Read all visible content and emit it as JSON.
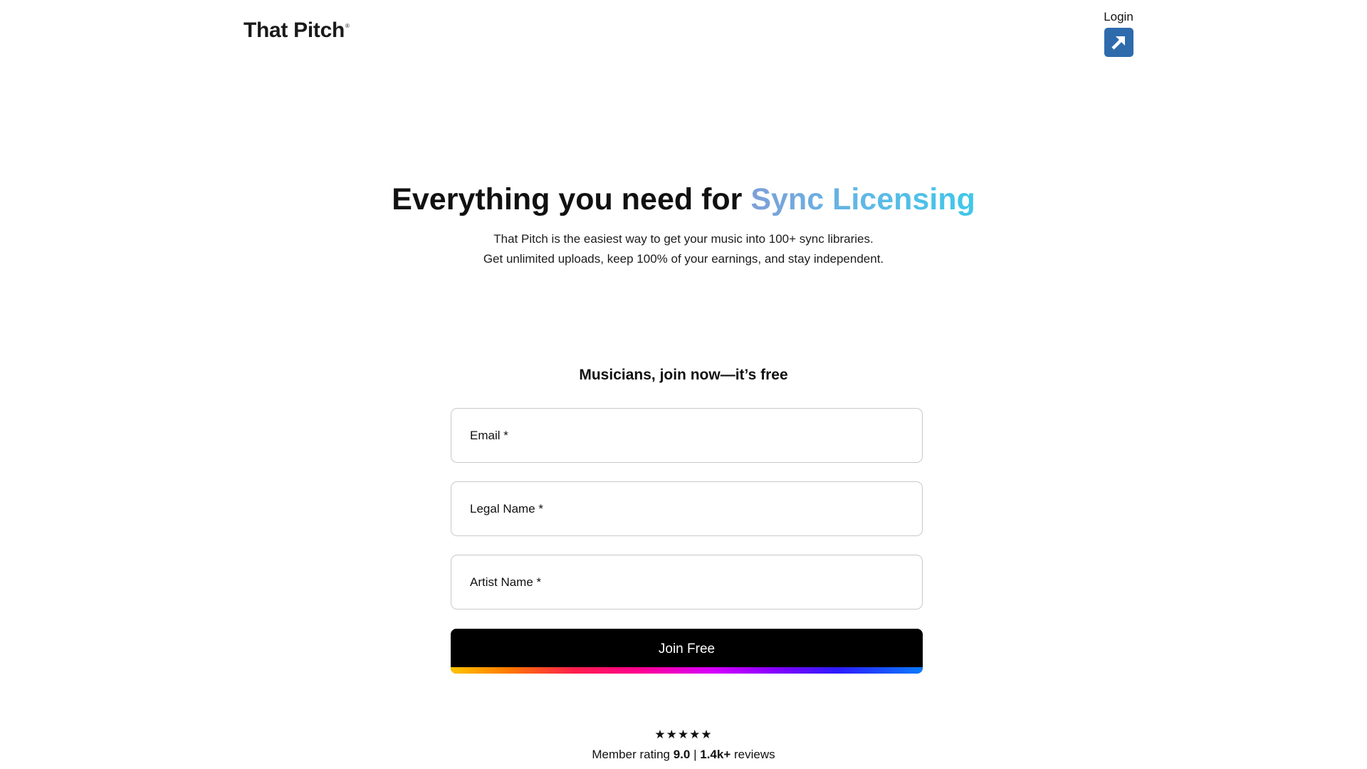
{
  "header": {
    "logo_text": "That Pitch",
    "logo_mark": "®",
    "login_label": "Login",
    "login_icon": "arrow-up-right-icon",
    "login_icon_color": "#2e6bad"
  },
  "hero": {
    "title_prefix": "Everything you need for ",
    "title_accent": "Sync Licensing",
    "subtitle_line1": "That Pitch is the easiest way to get your music into 100+ sync libraries.",
    "subtitle_line2": "Get unlimited uploads, keep 100% of your earnings, and stay independent."
  },
  "signup": {
    "heading": "Musicians, join now—it’s free",
    "fields": [
      {
        "label": "Email *",
        "value": ""
      },
      {
        "label": "Legal Name *",
        "value": ""
      },
      {
        "label": "Artist Name *",
        "value": ""
      }
    ],
    "submit_label": "Join Free"
  },
  "rating": {
    "stars": "★★★★★",
    "prefix": "Member rating ",
    "score": "9.0",
    "separator": " | ",
    "count": "1.4k+",
    "suffix": " reviews"
  }
}
